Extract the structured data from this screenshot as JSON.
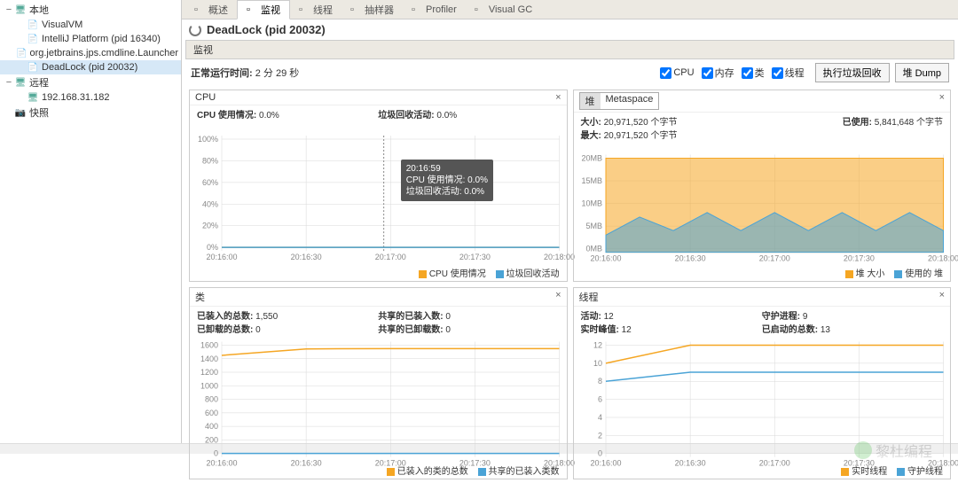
{
  "sidebar": {
    "nodes": [
      {
        "lvl": 1,
        "toggle": "−",
        "icon": "🖥",
        "color": "#5a9",
        "label": "本地"
      },
      {
        "lvl": 2,
        "toggle": "",
        "icon": "📄",
        "color": "#e90",
        "label": "VisualVM"
      },
      {
        "lvl": 2,
        "toggle": "",
        "icon": "📄",
        "color": "#e90",
        "label": "IntelliJ Platform (pid 16340)"
      },
      {
        "lvl": 2,
        "toggle": "",
        "icon": "📄",
        "color": "#e90",
        "label": "org.jetbrains.jps.cmdline.Launcher (p"
      },
      {
        "lvl": 2,
        "toggle": "",
        "icon": "📄",
        "color": "#8a3",
        "label": "DeadLock (pid 20032)",
        "sel": true
      },
      {
        "lvl": 1,
        "toggle": "−",
        "icon": "🖥",
        "color": "#5a9",
        "label": "远程"
      },
      {
        "lvl": 2,
        "toggle": "",
        "icon": "🖥",
        "color": "#5a9",
        "label": "192.168.31.182"
      },
      {
        "lvl": 1,
        "toggle": "",
        "icon": "📷",
        "color": "#888",
        "label": "快照"
      }
    ]
  },
  "tabs": [
    {
      "label": "概述",
      "active": false
    },
    {
      "label": "监视",
      "active": true
    },
    {
      "label": "线程",
      "active": false
    },
    {
      "label": "抽样器",
      "active": false
    },
    {
      "label": "Profiler",
      "active": false
    },
    {
      "label": "Visual GC",
      "active": false
    }
  ],
  "title": "DeadLock (pid 20032)",
  "section_label": "监视",
  "checks": [
    "CPU",
    "内存",
    "类",
    "线程"
  ],
  "uptime_label": "正常运行时间:",
  "uptime_value": "2 分 29 秒",
  "buttons": {
    "gc": "执行垃圾回收",
    "dump": "堆 Dump"
  },
  "cpu": {
    "title": "CPU",
    "stat1_l": "CPU 使用情况:",
    "stat1_v": "0.0%",
    "stat2_l": "垃圾回收活动:",
    "stat2_v": "0.0%",
    "tooltip_time": "20:16:59",
    "tooltip_l1": "CPU 使用情况: 0.0%",
    "tooltip_l2": "垃圾回收活动: 0.0%",
    "legend1": "CPU 使用情况",
    "legend2": "垃圾回收活动"
  },
  "heap": {
    "tab1": "堆",
    "tab2": "Metaspace",
    "stat1_l": "大小:",
    "stat1_v": "20,971,520 个字节",
    "stat2_l": "最大:",
    "stat2_v": "20,971,520 个字节",
    "stat3_l": "已使用:",
    "stat3_v": "5,841,648 个字节",
    "legend1": "堆 大小",
    "legend2": "使用的 堆"
  },
  "classes": {
    "title": "类",
    "stat1_l": "已装入的总数:",
    "stat1_v": "1,550",
    "stat2_l": "共享的已装入数:",
    "stat2_v": "0",
    "stat3_l": "已卸载的总数:",
    "stat3_v": "0",
    "stat4_l": "共享的已卸载数:",
    "stat4_v": "0",
    "legend1": "已装入的类的总数",
    "legend2": "共享的已装入类数"
  },
  "threads": {
    "title": "线程",
    "stat1_l": "活动:",
    "stat1_v": "12",
    "stat2_l": "守护进程:",
    "stat2_v": "9",
    "stat3_l": "实时峰值:",
    "stat3_v": "12",
    "stat4_l": "已启动的总数:",
    "stat4_v": "13",
    "legend1": "实时线程",
    "legend2": "守护线程"
  },
  "xticks": [
    "20:16:00",
    "20:16:30",
    "20:17:00",
    "20:17:30",
    "20:18:00"
  ],
  "colors": {
    "orange": "#f5a623",
    "blue": "#4aa3d6",
    "grid": "#d8d8d8"
  },
  "watermark": "黎杜编程",
  "chart_data": [
    {
      "type": "line",
      "title": "CPU",
      "x": [
        "20:16:00",
        "20:16:30",
        "20:17:00",
        "20:17:30",
        "20:18:00"
      ],
      "series": [
        {
          "name": "CPU 使用情况",
          "values": [
            0,
            0,
            0,
            0,
            0
          ]
        },
        {
          "name": "垃圾回收活动",
          "values": [
            0,
            0,
            0,
            0,
            0
          ]
        }
      ],
      "ylim": [
        0,
        100
      ],
      "yticks": [
        0,
        20,
        40,
        60,
        80,
        100
      ],
      "yunit": "%"
    },
    {
      "type": "area",
      "title": "堆",
      "x": [
        "20:16:00",
        "20:16:30",
        "20:17:00",
        "20:17:30",
        "20:18:00"
      ],
      "series": [
        {
          "name": "堆 大小",
          "values": [
            20,
            20,
            20,
            20,
            20
          ]
        },
        {
          "name": "使用的 堆",
          "values": [
            3,
            7,
            4,
            8,
            4,
            8,
            4,
            8,
            4,
            8,
            4
          ]
        }
      ],
      "ylim": [
        0,
        20
      ],
      "yticks": [
        0,
        5,
        10,
        15,
        20
      ],
      "yunit": "MB"
    },
    {
      "type": "line",
      "title": "类",
      "x": [
        "20:16:00",
        "20:16:30",
        "20:17:00",
        "20:17:30",
        "20:18:00"
      ],
      "series": [
        {
          "name": "已装入的类的总数",
          "values": [
            1450,
            1545,
            1550,
            1550,
            1550
          ]
        },
        {
          "name": "共享的已装入类数",
          "values": [
            0,
            0,
            0,
            0,
            0
          ]
        }
      ],
      "ylim": [
        0,
        1600
      ],
      "yticks": [
        0,
        200,
        400,
        600,
        800,
        1000,
        1200,
        1400,
        1600
      ]
    },
    {
      "type": "line",
      "title": "线程",
      "x": [
        "20:16:00",
        "20:16:30",
        "20:17:00",
        "20:17:30",
        "20:18:00"
      ],
      "series": [
        {
          "name": "实时线程",
          "values": [
            10,
            12,
            12,
            12,
            12
          ]
        },
        {
          "name": "守护线程",
          "values": [
            8,
            9,
            9,
            9,
            9
          ]
        }
      ],
      "ylim": [
        0,
        12
      ],
      "yticks": [
        0,
        2,
        4,
        6,
        8,
        10,
        12
      ]
    }
  ]
}
